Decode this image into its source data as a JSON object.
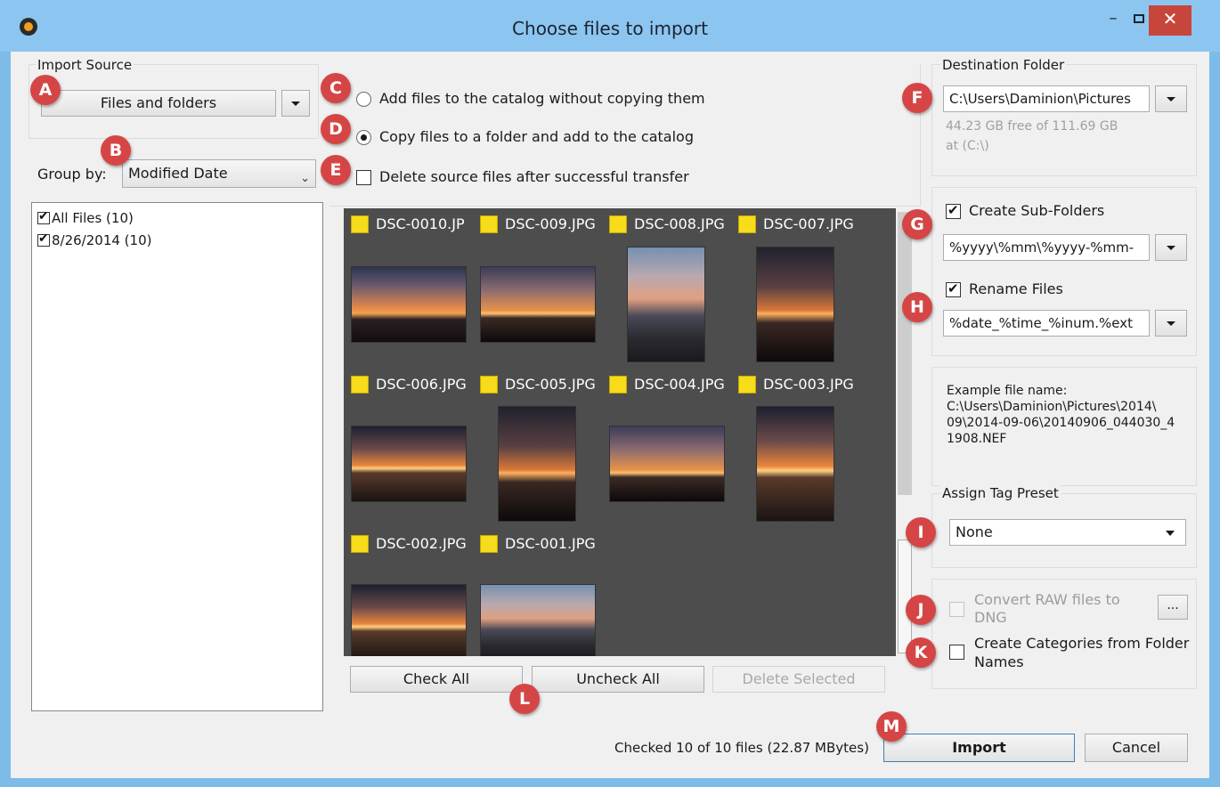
{
  "window": {
    "title": "Choose files to import",
    "minimize_label": "–",
    "close_label": "✕"
  },
  "import_source": {
    "group_label": "Import Source",
    "button_label": "Files and folders"
  },
  "group_by": {
    "label": "Group by:",
    "selected": "Modified Date"
  },
  "copy_options": {
    "add_without_copy": "Add files to the catalog without copying them",
    "copy_to_folder": "Copy files to a folder and add to the catalog",
    "delete_source": "Delete source files after successful transfer",
    "selected": "copy_to_folder"
  },
  "tree": {
    "items": [
      {
        "label": "All Files (10)",
        "checked": true
      },
      {
        "label": "8/26/2014 (10)",
        "checked": true
      }
    ]
  },
  "gallery": {
    "files": [
      {
        "name": "DSC-0010.JP"
      },
      {
        "name": "DSC-009.JPG"
      },
      {
        "name": "DSC-008.JPG"
      },
      {
        "name": "DSC-007.JPG"
      },
      {
        "name": "DSC-006.JPG"
      },
      {
        "name": "DSC-005.JPG"
      },
      {
        "name": "DSC-004.JPG"
      },
      {
        "name": "DSC-003.JPG"
      },
      {
        "name": "DSC-002.JPG"
      },
      {
        "name": "DSC-001.JPG"
      }
    ]
  },
  "gallery_buttons": {
    "check_all": "Check All",
    "uncheck_all": "Uncheck All",
    "delete_selected": "Delete Selected"
  },
  "destination": {
    "group_label": "Destination Folder",
    "path": "C:\\Users\\Daminion\\Pictures",
    "free_space": "44.23 GB free of 111.69 GB",
    "drive": "at  (C:\\)"
  },
  "subfolders": {
    "label": "Create Sub-Folders",
    "checked": true,
    "pattern": "%yyyy\\%mm\\%yyyy-%mm-"
  },
  "rename": {
    "label": "Rename Files",
    "checked": true,
    "pattern": "%date_%time_%inum.%ext"
  },
  "example": {
    "text": "Example file name:\nC:\\Users\\Daminion\\Pictures\\2014\\\n09\\2014-09-06\\20140906_044030_4\n1908.NEF"
  },
  "tag_preset": {
    "group_label": "Assign Tag Preset",
    "selected": "None"
  },
  "raw": {
    "label_line1": "Convert RAW files to",
    "label_line2": "DNG",
    "more_label": "..."
  },
  "categories": {
    "label_line1": "Create Categories from Folder",
    "label_line2": "Names"
  },
  "footer": {
    "status": "Checked 10 of 10 files (22.87 MBytes)",
    "import_label": "Import",
    "cancel_label": "Cancel"
  },
  "markers": [
    "A",
    "B",
    "C",
    "D",
    "E",
    "F",
    "G",
    "H",
    "I",
    "J",
    "K",
    "L",
    "M"
  ],
  "colors": {
    "titlebar": "#8cc6f0",
    "marker": "#d64545",
    "close_button": "#c7463c",
    "gallery_bg": "#4d4d4d",
    "thumb_check": "#f6dc1a"
  }
}
